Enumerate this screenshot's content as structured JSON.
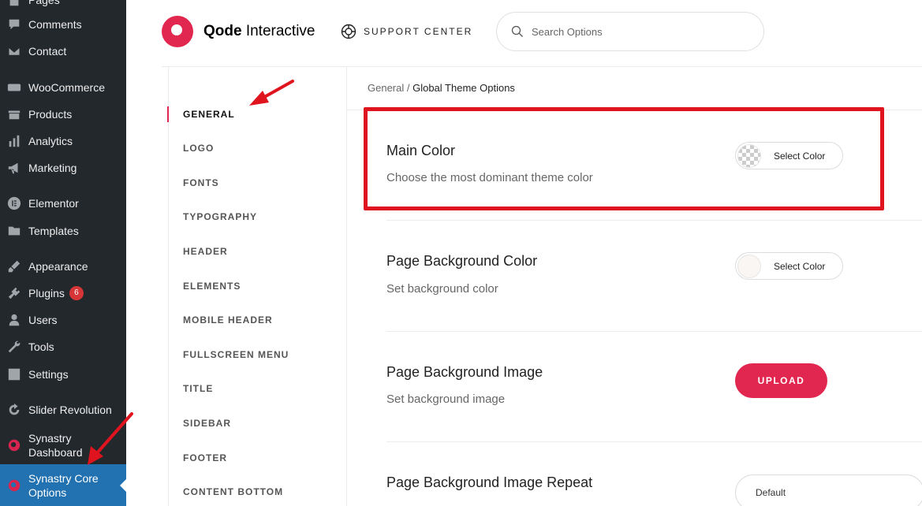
{
  "wp_sidebar": {
    "items": [
      {
        "label": "Pages",
        "icon": "pages-icon"
      },
      {
        "label": "Comments",
        "icon": "comments-icon"
      },
      {
        "label": "Contact",
        "icon": "mail-icon"
      },
      {
        "label": "WooCommerce",
        "icon": "woocommerce-icon"
      },
      {
        "label": "Products",
        "icon": "products-icon"
      },
      {
        "label": "Analytics",
        "icon": "analytics-icon"
      },
      {
        "label": "Marketing",
        "icon": "megaphone-icon"
      },
      {
        "label": "Elementor",
        "icon": "elementor-icon"
      },
      {
        "label": "Templates",
        "icon": "folder-icon"
      },
      {
        "label": "Appearance",
        "icon": "brush-icon"
      },
      {
        "label": "Plugins",
        "icon": "plugin-icon",
        "badge": "6"
      },
      {
        "label": "Users",
        "icon": "user-icon"
      },
      {
        "label": "Tools",
        "icon": "wrench-icon"
      },
      {
        "label": "Settings",
        "icon": "settings-icon"
      },
      {
        "label": "Slider Revolution",
        "icon": "refresh-icon"
      },
      {
        "label": "Synastry Dashboard",
        "icon": "synastry-icon"
      },
      {
        "label": "Synastry Core Options",
        "icon": "synastry-icon",
        "active": true
      }
    ]
  },
  "header": {
    "brand_bold": "Qode",
    "brand_rest": " Interactive",
    "support_label": "SUPPORT CENTER",
    "search_placeholder": "Search Options"
  },
  "options_nav": {
    "items": [
      "GENERAL",
      "LOGO",
      "FONTS",
      "TYPOGRAPHY",
      "HEADER",
      "ELEMENTS",
      "MOBILE HEADER",
      "FULLSCREEN MENU",
      "TITLE",
      "SIDEBAR",
      "FOOTER",
      "CONTENT BOTTOM"
    ],
    "active": "GENERAL"
  },
  "breadcrumb": {
    "parent": "General",
    "separator": " / ",
    "current": "Global Theme Options"
  },
  "options": {
    "main_color": {
      "title": "Main Color",
      "description": "Choose the most dominant theme color",
      "button": "Select Color"
    },
    "page_bg_color": {
      "title": "Page Background Color",
      "description": "Set background color",
      "button": "Select Color"
    },
    "page_bg_image": {
      "title": "Page Background Image",
      "description": "Set background image",
      "button": "UPLOAD"
    },
    "page_bg_repeat": {
      "title": "Page Background Image Repeat",
      "value": "Default"
    }
  },
  "colors": {
    "accent": "#e1274f",
    "wp_sidebar_bg": "#23282d",
    "wp_active": "#2271b1",
    "annotation_red": "#e0141e"
  }
}
